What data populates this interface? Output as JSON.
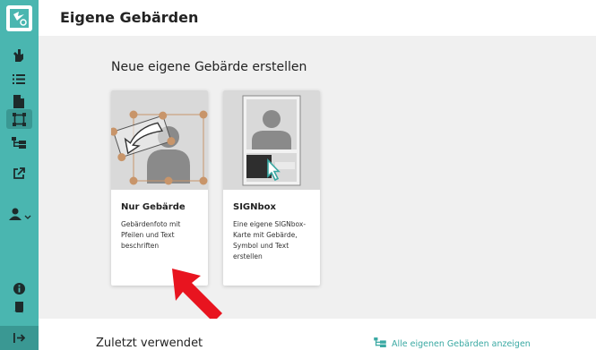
{
  "header": {
    "title": "Eigene Gebärden"
  },
  "main": {
    "section_title": "Neue eigene Gebärde erstellen",
    "cards": [
      {
        "title": "Nur Gebärde",
        "description": "Gebärdenfoto mit Pfeilen und Text beschriften"
      },
      {
        "title": "SIGNbox",
        "description": "Eine eigene SIGNbox-Karte mit Gebärde, Symbol und Text erstellen"
      }
    ]
  },
  "footer": {
    "recent_title": "Zuletzt verwendet",
    "show_all_label": "Alle eigenen Gebärden anzeigen"
  },
  "sidebar": {
    "icons": [
      "app-logo-icon",
      "hand-icon",
      "list-icon",
      "document-icon",
      "crop-frame-icon",
      "hierarchy-icon",
      "external-link-icon",
      "user-icon",
      "info-icon",
      "scroll-icon",
      "expand-sidebar-icon"
    ]
  },
  "colors": {
    "sidebar": "#4ab6b0",
    "sidebar_active": "#3a9893",
    "accent": "#3aa9a3",
    "annotation_arrow": "#e8141f"
  }
}
